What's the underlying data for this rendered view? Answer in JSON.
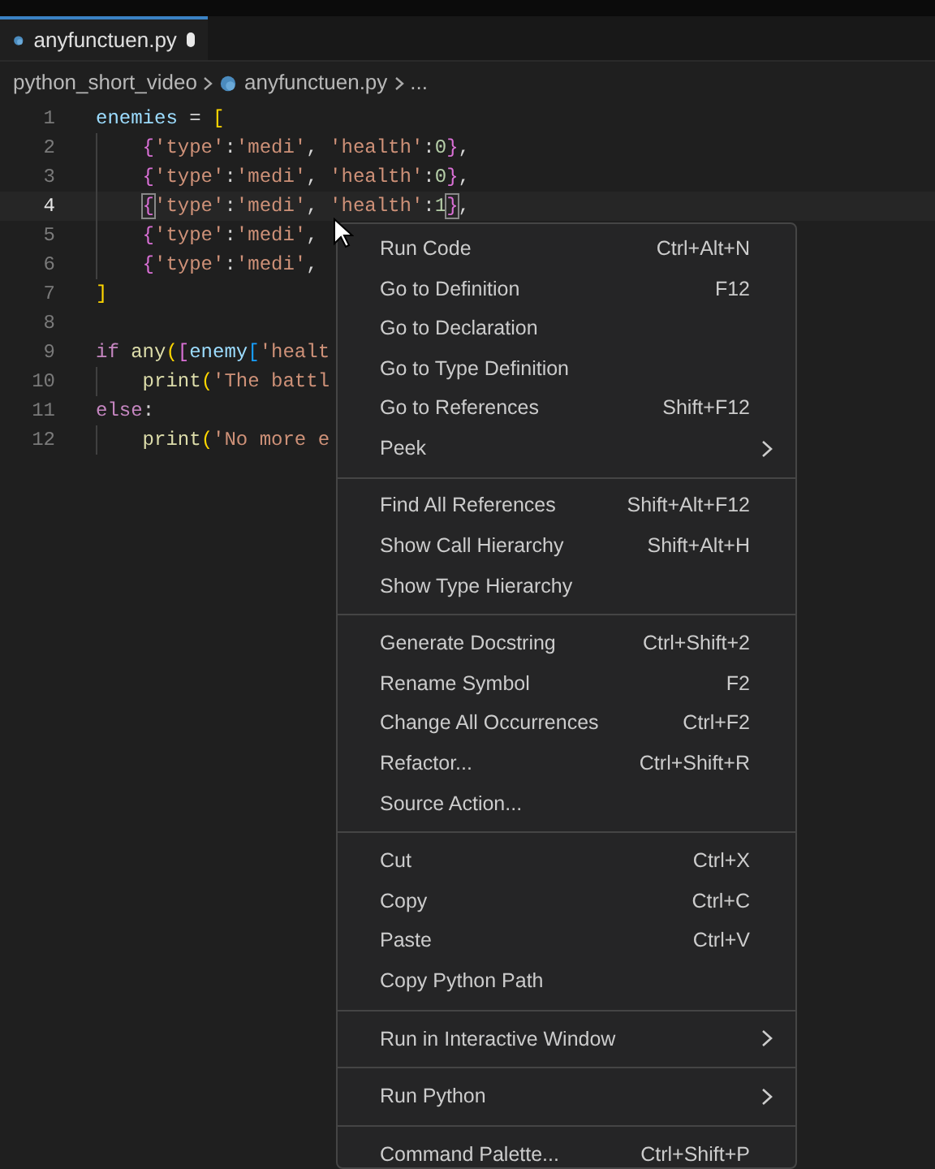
{
  "tab": {
    "title": "anyfunctuen.py",
    "modified": true
  },
  "breadcrumb": [
    "python_short_video",
    "anyfunctuen.py",
    "..."
  ],
  "code_lines": [
    {
      "number": "1",
      "current": false,
      "indented": false,
      "tokens": [
        {
          "kind": "var",
          "text": "enemies"
        },
        {
          "kind": "op",
          "text": " = "
        },
        {
          "kind": "bracket1",
          "text": "["
        }
      ]
    },
    {
      "number": "2",
      "current": false,
      "indented": true,
      "tokens": [
        {
          "kind": "bracket2",
          "text": "{"
        },
        {
          "kind": "string",
          "text": "'type'"
        },
        {
          "kind": "op",
          "text": ":"
        },
        {
          "kind": "string",
          "text": "'medi'"
        },
        {
          "kind": "op",
          "text": ", "
        },
        {
          "kind": "string",
          "text": "'health'"
        },
        {
          "kind": "op",
          "text": ":"
        },
        {
          "kind": "number",
          "text": "0"
        },
        {
          "kind": "bracket2",
          "text": "}"
        },
        {
          "kind": "op",
          "text": ","
        }
      ]
    },
    {
      "number": "3",
      "current": false,
      "indented": true,
      "tokens": [
        {
          "kind": "bracket2",
          "text": "{"
        },
        {
          "kind": "string",
          "text": "'type'"
        },
        {
          "kind": "op",
          "text": ":"
        },
        {
          "kind": "string",
          "text": "'medi'"
        },
        {
          "kind": "op",
          "text": ", "
        },
        {
          "kind": "string",
          "text": "'health'"
        },
        {
          "kind": "op",
          "text": ":"
        },
        {
          "kind": "number",
          "text": "0"
        },
        {
          "kind": "bracket2",
          "text": "}"
        },
        {
          "kind": "op",
          "text": ","
        }
      ]
    },
    {
      "number": "4",
      "current": true,
      "indented": true,
      "tokens": [
        {
          "kind": "bracket_match",
          "text": "{"
        },
        {
          "kind": "string",
          "text": "'type'"
        },
        {
          "kind": "op",
          "text": ":"
        },
        {
          "kind": "string",
          "text": "'medi'"
        },
        {
          "kind": "op",
          "text": ", "
        },
        {
          "kind": "string",
          "text": "'health'"
        },
        {
          "kind": "op",
          "text": ":"
        },
        {
          "kind": "number",
          "text": "1"
        },
        {
          "kind": "bracket_match",
          "text": "}"
        },
        {
          "kind": "op",
          "text": ","
        }
      ]
    },
    {
      "number": "5",
      "current": false,
      "indented": true,
      "tokens": [
        {
          "kind": "bracket2",
          "text": "{"
        },
        {
          "kind": "string",
          "text": "'type'"
        },
        {
          "kind": "op",
          "text": ":"
        },
        {
          "kind": "string",
          "text": "'medi'"
        },
        {
          "kind": "op",
          "text": ","
        }
      ]
    },
    {
      "number": "6",
      "current": false,
      "indented": true,
      "tokens": [
        {
          "kind": "bracket2",
          "text": "{"
        },
        {
          "kind": "string",
          "text": "'type'"
        },
        {
          "kind": "op",
          "text": ":"
        },
        {
          "kind": "string",
          "text": "'medi'"
        },
        {
          "kind": "op",
          "text": ","
        }
      ]
    },
    {
      "number": "7",
      "current": false,
      "indented": false,
      "tokens": [
        {
          "kind": "bracket1",
          "text": "]"
        }
      ]
    },
    {
      "number": "8",
      "current": false
    },
    {
      "number": "9",
      "current": false,
      "indented": false,
      "tokens": [
        {
          "kind": "keyword",
          "text": "if"
        },
        {
          "kind": "function",
          "text": "any"
        },
        {
          "kind": "bracket1",
          "text": "("
        },
        {
          "kind": "bracket2",
          "text": "["
        },
        {
          "kind": "var",
          "text": "enemy"
        },
        {
          "kind": "bracket3",
          "text": "["
        },
        {
          "kind": "string",
          "text": "'healt"
        }
      ]
    },
    {
      "number": "10",
      "current": false,
      "indented": true,
      "tokens": [
        {
          "kind": "function",
          "text": "print"
        },
        {
          "kind": "bracket1",
          "text": "("
        },
        {
          "kind": "string",
          "text": "'The battl"
        }
      ]
    },
    {
      "number": "11",
      "current": false,
      "indented": false,
      "tokens": [
        {
          "kind": "keyword",
          "text": "else"
        },
        {
          "kind": "op",
          "text": ":"
        }
      ]
    },
    {
      "number": "12",
      "current": false,
      "indented": true,
      "tokens": [
        {
          "kind": "function",
          "text": "print"
        },
        {
          "kind": "bracket1",
          "text": "("
        },
        {
          "kind": "string",
          "text": "'No more e"
        }
      ]
    }
  ],
  "context_menu": [
    [
      {
        "label": "Run Code",
        "shortcut": "Ctrl+Alt+N",
        "submenu": false
      },
      {
        "label": "Go to Definition",
        "shortcut": "F12",
        "submenu": false
      },
      {
        "label": "Go to Declaration",
        "submenu": false
      },
      {
        "label": "Go to Type Definition",
        "submenu": false
      },
      {
        "label": "Go to References",
        "shortcut": "Shift+F12",
        "submenu": false
      },
      {
        "label": "Peek",
        "submenu": true
      }
    ],
    [
      {
        "label": "Find All References",
        "shortcut": "Shift+Alt+F12",
        "submenu": false
      },
      {
        "label": "Show Call Hierarchy",
        "shortcut": "Shift+Alt+H",
        "submenu": false
      },
      {
        "label": "Show Type Hierarchy",
        "submenu": false
      }
    ],
    [
      {
        "label": "Generate Docstring",
        "shortcut": "Ctrl+Shift+2",
        "submenu": false
      },
      {
        "label": "Rename Symbol",
        "shortcut": "F2",
        "submenu": false
      },
      {
        "label": "Change All Occurrences",
        "shortcut": "Ctrl+F2",
        "submenu": false
      },
      {
        "label": "Refactor...",
        "shortcut": "Ctrl+Shift+R",
        "submenu": false
      },
      {
        "label": "Source Action...",
        "submenu": false
      }
    ],
    [
      {
        "label": "Cut",
        "shortcut": "Ctrl+X",
        "submenu": false
      },
      {
        "label": "Copy",
        "shortcut": "Ctrl+C",
        "submenu": false
      },
      {
        "label": "Paste",
        "shortcut": "Ctrl+V",
        "submenu": false
      },
      {
        "label": "Copy Python Path",
        "submenu": false
      }
    ],
    [
      {
        "label": "Run in Interactive Window",
        "submenu": true
      }
    ],
    [
      {
        "label": "Run Python",
        "submenu": true
      }
    ],
    [
      {
        "label": "Command Palette...",
        "shortcut": "Ctrl+Shift+P",
        "submenu": false
      }
    ]
  ]
}
